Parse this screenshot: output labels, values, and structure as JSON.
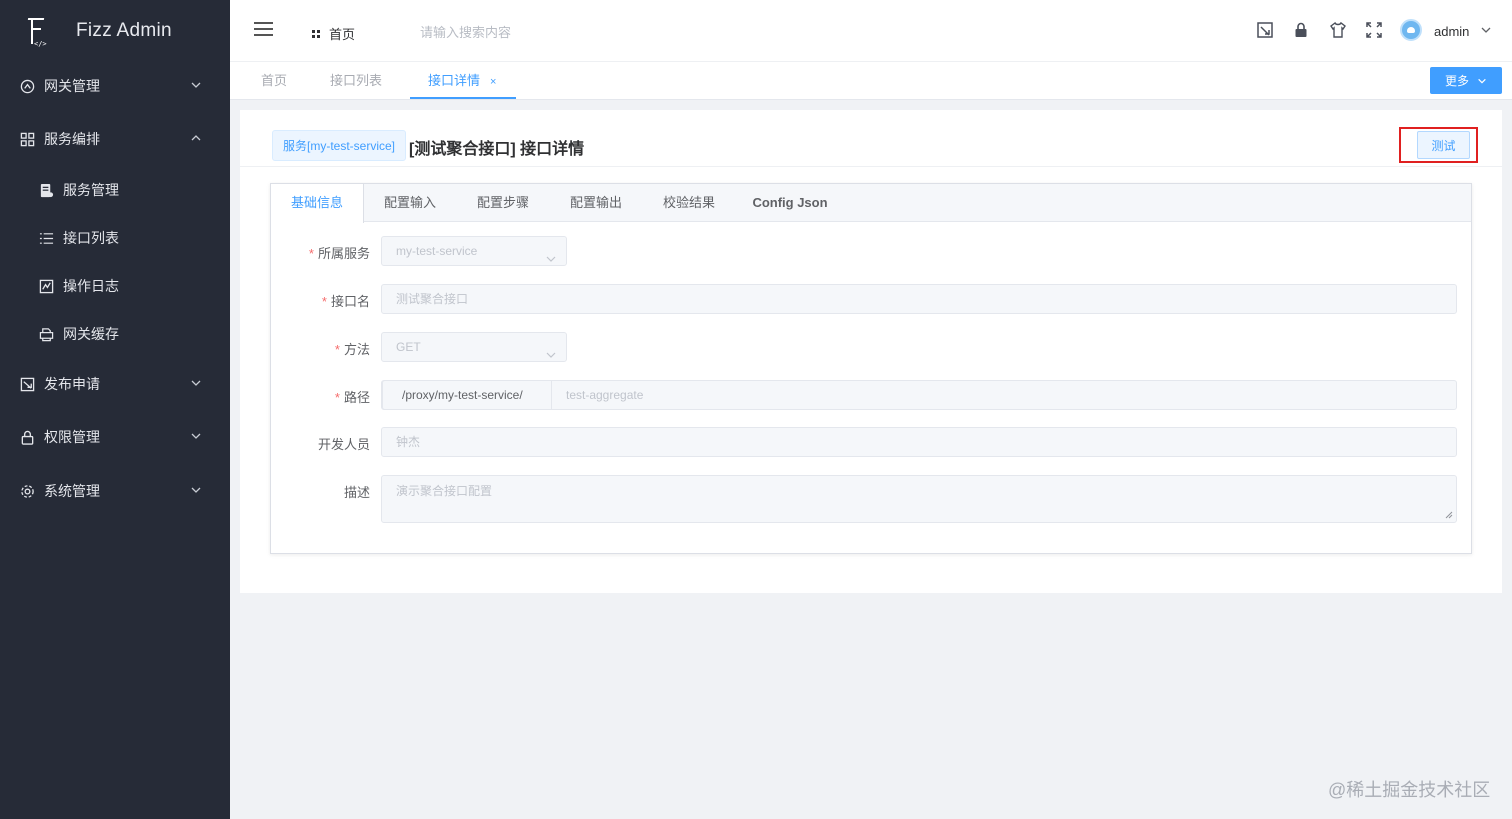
{
  "app": {
    "title": "Fizz Admin",
    "logo_tag": "</>"
  },
  "sidebar": {
    "items": [
      {
        "label": "网关管理",
        "icon": "gateway-icon",
        "expanded": false
      },
      {
        "label": "服务编排",
        "icon": "apps-grid-icon",
        "expanded": true
      },
      {
        "label": "服务管理",
        "icon": "document-list-icon",
        "child": true
      },
      {
        "label": "接口列表",
        "icon": "list-icon",
        "child": true
      },
      {
        "label": "操作日志",
        "icon": "log-icon",
        "child": true
      },
      {
        "label": "网关缓存",
        "icon": "printer-icon",
        "child": true
      },
      {
        "label": "发布申请",
        "icon": "publish-icon",
        "expanded": false
      },
      {
        "label": "权限管理",
        "icon": "lock-icon",
        "expanded": false
      },
      {
        "label": "系统管理",
        "icon": "gear-icon",
        "expanded": false
      }
    ]
  },
  "header": {
    "breadcrumb": "首页",
    "search_placeholder": "请输入搜索内容",
    "user": "admin",
    "tools": [
      "screenshot-icon",
      "lock-icon",
      "theme-shirt-icon",
      "fullscreen-icon"
    ]
  },
  "page_tabs": [
    {
      "label": "首页",
      "active": false
    },
    {
      "label": "接口列表",
      "active": false
    },
    {
      "label": "接口详情",
      "active": true,
      "close": "×"
    }
  ],
  "more_button": "更多",
  "detail": {
    "service_tag": "服务[my-test-service]",
    "title": "[测试聚合接口] 接口详情",
    "test_button": "测试",
    "tabs": [
      {
        "label": "基础信息",
        "active": true
      },
      {
        "label": "配置输入",
        "active": false
      },
      {
        "label": "配置步骤",
        "active": false
      },
      {
        "label": "配置输出",
        "active": false
      },
      {
        "label": "校验结果",
        "active": false
      },
      {
        "label": "Config Json",
        "active": false
      }
    ],
    "form": {
      "service": {
        "label": "所属服务",
        "required": true,
        "value": "my-test-service"
      },
      "name": {
        "label": "接口名",
        "required": true,
        "value": "测试聚合接口"
      },
      "method": {
        "label": "方法",
        "required": true,
        "value": "GET"
      },
      "path": {
        "label": "路径",
        "required": true,
        "prefix": "/proxy/my-test-service/",
        "value": "test-aggregate"
      },
      "developer": {
        "label": "开发人员",
        "required": false,
        "value": "钟杰"
      },
      "description": {
        "label": "描述",
        "required": false,
        "value": "演示聚合接口配置"
      }
    }
  },
  "watermark": "@稀土掘金技术社区",
  "colors": {
    "sidebar": "#262b37",
    "primary": "#409eff",
    "highlight": "#e02020"
  }
}
